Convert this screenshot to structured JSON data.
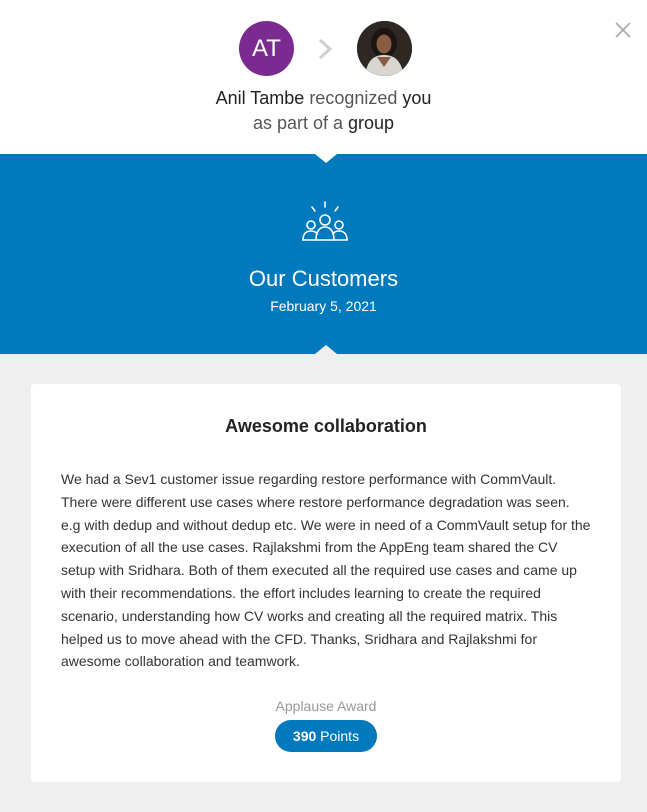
{
  "header": {
    "initials": "AT",
    "initials_color": "#7b2b8f",
    "close_icon": "close-icon",
    "headline": {
      "name": "Anil Tambe",
      "verb": "recognized",
      "object": "you",
      "line2_prefix": "as part of a",
      "line2_strong": "group"
    }
  },
  "banner": {
    "icon": "team-icon",
    "title": "Our Customers",
    "date": "February 5, 2021",
    "color": "#0079bd"
  },
  "card": {
    "title": "Awesome collaboration",
    "body": "We had a Sev1 customer issue regarding restore performance with CommVault. There were different use cases where restore performance degradation was seen. e.g with dedup and without dedup etc. We were in need of a CommVault setup for the execution of all the use cases. Rajlakshmi from the AppEng team shared the CV setup with Sridhara. Both of them executed all the required use cases and came up with their recommendations. the effort includes learning to create the required scenario, understanding how CV works and creating all the required matrix. This helped us to move ahead with the CFD. Thanks, Sridhara and Rajlakshmi for awesome collaboration and teamwork.",
    "award_label": "Applause Award",
    "points_value": "390",
    "points_unit": "Points"
  }
}
